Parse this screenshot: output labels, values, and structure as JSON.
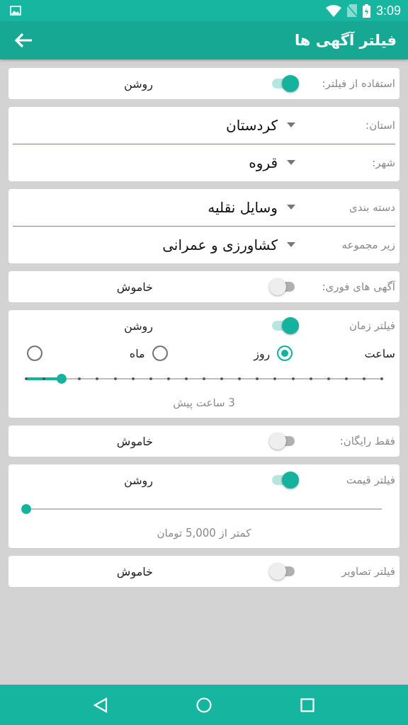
{
  "status_bar": {
    "time": "3:09"
  },
  "app_bar": {
    "title": "فیلتر آگهی ها"
  },
  "sections": [
    {
      "kind": "toggle",
      "label": "استفاده از فیلتر:",
      "on": true,
      "state_text": "روشن"
    },
    {
      "kind": "dropdowns",
      "fields": [
        {
          "label": "استان:",
          "value": "کردستان",
          "focused": true
        },
        {
          "label": "شهر:",
          "value": "قروه",
          "focused": false
        }
      ]
    },
    {
      "kind": "dropdowns",
      "fields": [
        {
          "label": "دسته بندی",
          "value": "وسایل نقلیه",
          "focused": true
        },
        {
          "label": "زیر مجموعه",
          "value": "کشاورزی و عمرانی",
          "focused": false
        }
      ]
    },
    {
      "kind": "toggle",
      "label": "آگهی های فوری:",
      "on": false,
      "state_text": "خاموش"
    },
    {
      "kind": "toggle",
      "label": "فیلتر زمان",
      "on": true,
      "state_text": "روشن",
      "options": [
        {
          "label": "ساعت",
          "selected": true
        },
        {
          "label": "روز",
          "selected": false
        },
        {
          "label": "ماه",
          "selected": false
        }
      ],
      "slider": {
        "kind": "ticks",
        "level": 0.1
      },
      "caption": "3 ساعت پیش"
    },
    {
      "kind": "toggle",
      "label": "فقط رایگان:",
      "on": false,
      "state_text": "خاموش"
    },
    {
      "kind": "toggle",
      "label": "فیلتر قیمت",
      "on": true,
      "state_text": "روشن",
      "slider": {
        "kind": "plain",
        "level": 0
      },
      "caption": "کمتر از 5,000 تومان"
    },
    {
      "kind": "toggle",
      "label": "فیلتر تصاویر",
      "on": false,
      "state_text": "خاموش"
    }
  ]
}
